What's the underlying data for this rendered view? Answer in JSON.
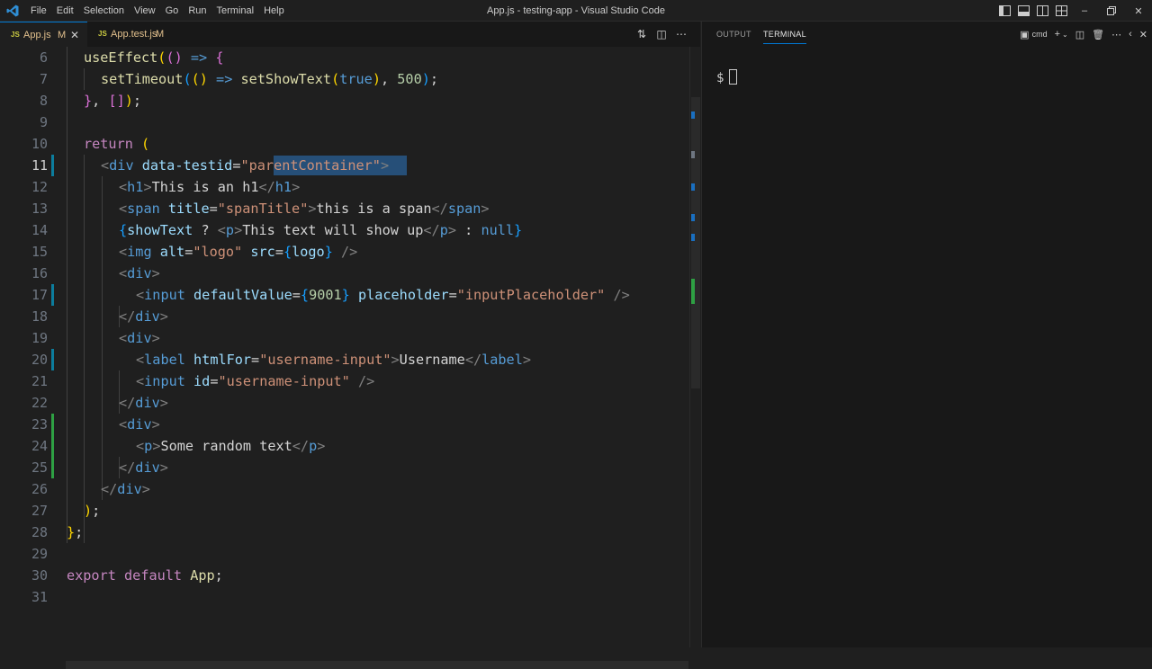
{
  "menu": [
    "File",
    "Edit",
    "Selection",
    "View",
    "Go",
    "Run",
    "Terminal",
    "Help"
  ],
  "window_title": "App.js - testing-app - Visual Studio Code",
  "tabs": [
    {
      "icon": "JS",
      "name": "App.js",
      "status": "M"
    },
    {
      "icon": "JS",
      "name": "App.test.js",
      "status": "M"
    }
  ],
  "panel": {
    "tabs": [
      "OUTPUT",
      "TERMINAL"
    ],
    "active_tab": "TERMINAL",
    "shell": "cmd",
    "prompt": "$"
  },
  "editor": {
    "active_line": 11,
    "line_numbers": [
      "6",
      "7",
      "8",
      "9",
      "10",
      "11",
      "12",
      "13",
      "14",
      "15",
      "16",
      "17",
      "18",
      "19",
      "20",
      "21",
      "22",
      "23",
      "24",
      "25",
      "26",
      "27",
      "28",
      "29",
      "30",
      "31"
    ]
  },
  "colors": {
    "accent": "#0078d4",
    "modified": "#e2c08d",
    "git_added": "#2ea043",
    "selection": "#264f78"
  }
}
